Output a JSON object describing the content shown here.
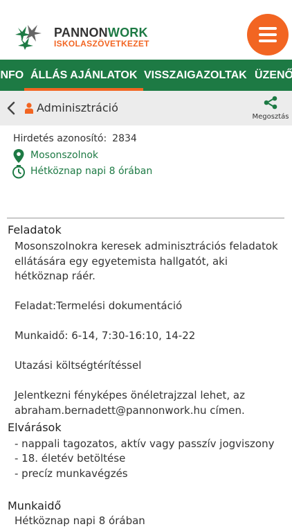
{
  "header": {
    "brand_first": "PANNON",
    "brand_second": "WORK",
    "brand_sub": "ISKOLASZÖVETKEZET"
  },
  "tabs": [
    {
      "label": "INFO",
      "active": false
    },
    {
      "label": "ÁLLÁS AJÁNLATOK",
      "active": true
    },
    {
      "label": "VISSZAIGAZOLTAK",
      "active": false
    },
    {
      "label": "ÜZENŐ",
      "active": false
    }
  ],
  "subbar": {
    "title": "Adminisztráció",
    "share_label": "Megosztás"
  },
  "job": {
    "id_label": "Hirdetés azonosító:",
    "id_value": "2834",
    "location": "Mosonszolnok",
    "schedule": "Hétköznap napi 8 órában"
  },
  "sections": {
    "tasks_title": "Feladatok",
    "tasks_text": [
      "Mosonszolnokra keresek adminisztrációs feladatok ellátására egy egyetemista hallgatót, aki hétköznap ráér.",
      "Feladat:Termelési dokumentáció",
      "Munkaidő: 6-14, 7:30-16:10, 14-22",
      "Utazási költségtérítéssel",
      "Jelentkezni fényképes önéletrajzzal lehet, az abraham.bernadett@pannonwork.hu címen."
    ],
    "req_title": "Elvárások",
    "requirements": [
      "- nappali tagozatos, aktív vagy passzív jogviszony",
      "- 18. életév betöltése",
      "- precíz munkavégzés"
    ],
    "worktime_title": "Munkaidő",
    "worktime_text": "Hétköznap napi 8 órában"
  },
  "colors": {
    "green": "#1d7a44",
    "orange": "#f26522"
  }
}
